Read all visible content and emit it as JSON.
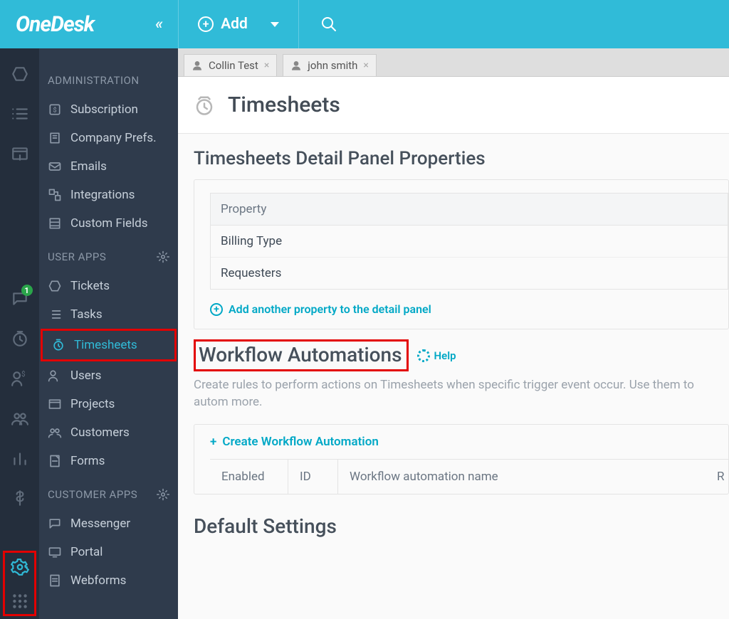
{
  "brand": "OneDesk",
  "topbar": {
    "add_label": "Add"
  },
  "badge_count": "1",
  "tabs": [
    {
      "label": "Collin Test"
    },
    {
      "label": "john smith"
    }
  ],
  "page": {
    "title": "Timesheets"
  },
  "section_props": {
    "title": "Timesheets Detail Panel Properties",
    "header": "Property",
    "rows": [
      "Billing Type",
      "Requesters"
    ],
    "add_link": "Add another property to the detail panel"
  },
  "workflow": {
    "title": "Workflow Automations",
    "help": "Help",
    "desc": "Create rules to perform actions on Timesheets when specific trigger event occur. Use them to autom more.",
    "create": "Create Workflow Automation",
    "cols": {
      "enabled": "Enabled",
      "id": "ID",
      "name": "Workflow automation name",
      "r": "R"
    }
  },
  "defaults": {
    "title": "Default Settings"
  },
  "sidepanel": {
    "admin_header": "ADMINISTRATION",
    "user_apps_header": "USER APPS",
    "customer_apps_header": "CUSTOMER APPS",
    "items": {
      "subscription": "Subscription",
      "company_prefs": "Company Prefs.",
      "emails": "Emails",
      "integrations": "Integrations",
      "custom_fields": "Custom Fields",
      "tickets": "Tickets",
      "tasks": "Tasks",
      "timesheets": "Timesheets",
      "users": "Users",
      "projects": "Projects",
      "customers": "Customers",
      "forms": "Forms",
      "messenger": "Messenger",
      "portal": "Portal",
      "webforms": "Webforms"
    }
  }
}
